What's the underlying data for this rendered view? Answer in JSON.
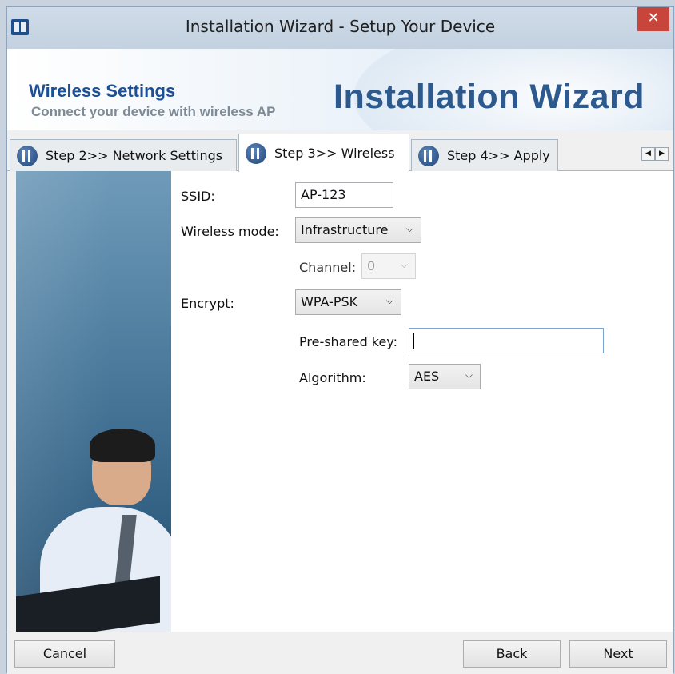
{
  "window": {
    "title": "Installation Wizard - Setup Your Device",
    "close_glyph": "✕"
  },
  "banner": {
    "title": "Wireless Settings",
    "subtitle": "Connect your device with wireless AP",
    "product": "Installation Wizard"
  },
  "tabs": [
    {
      "label": "Step 2>> Network Settings",
      "active": false,
      "icon": "tools-icon"
    },
    {
      "label": "Step 3>> Wireless",
      "active": true,
      "icon": "tools-icon"
    },
    {
      "label": "Step 4>> Apply",
      "active": false,
      "icon": "tools-icon"
    }
  ],
  "tab_scroll": {
    "left_glyph": "◀",
    "right_glyph": "▶"
  },
  "form": {
    "ssid": {
      "label": "SSID:",
      "value": "AP-123"
    },
    "mode": {
      "label": "Wireless mode:",
      "value": "Infrastructure"
    },
    "channel": {
      "label": "Channel:",
      "value": "0",
      "disabled": true
    },
    "encrypt": {
      "label": "Encrypt:",
      "value": "WPA-PSK"
    },
    "psk": {
      "label": "Pre-shared key:",
      "value": ""
    },
    "algorithm": {
      "label": "Algorithm:",
      "value": "AES"
    },
    "chevron_glyph": "⌵"
  },
  "footer": {
    "cancel": "Cancel",
    "back": "Back",
    "next": "Next"
  },
  "colors": {
    "banner_title": "#1c4f94",
    "product": "#2c5a8e",
    "close_button": "#c7453b"
  }
}
